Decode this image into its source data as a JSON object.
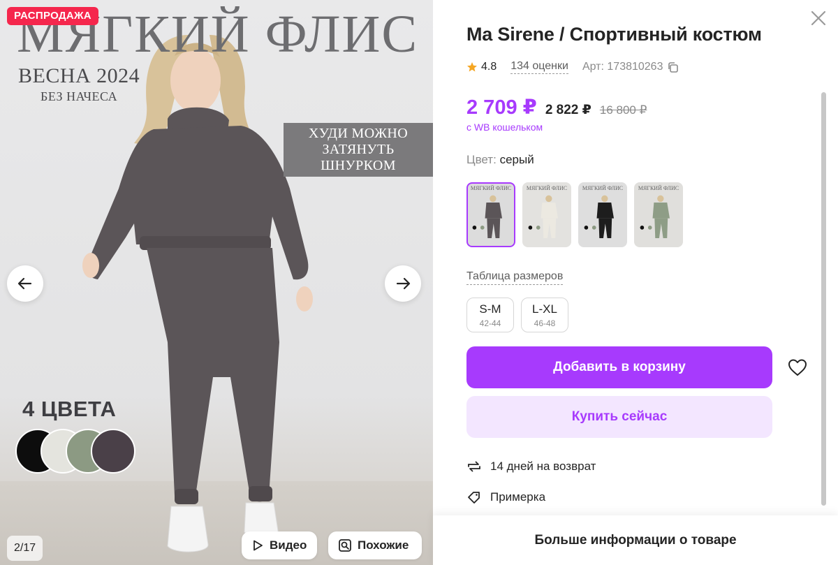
{
  "gallery": {
    "sale_badge": "РАСПРОДАЖА",
    "promo_title": "МЯГКИЙ ФЛИС",
    "promo_season": "ВЕСНА 2024",
    "promo_subtitle": "БЕЗ НАЧЕСА",
    "promo_hoodie_line1": "ХУДИ МОЖНО",
    "promo_hoodie_line2": "ЗАТЯНУТЬ ШНУРКОМ",
    "colors_title": "4 ЦВЕТА",
    "swatch_colors": [
      "#0d0d0d",
      "#e4e4de",
      "#8c9a83",
      "#4a4048"
    ],
    "counter": "2/17",
    "video_label": "Видео",
    "similar_label": "Похожие",
    "suit_color": "#5b5558"
  },
  "product": {
    "title": "Ma Sirene / Спортивный костюм",
    "rating": "4.8",
    "reviews": "134 оценки",
    "article": "Арт: 173810263",
    "price_wallet": "2 709 ₽",
    "price_regular": "2 822 ₽",
    "price_old": "16 800 ₽",
    "wallet_note": "с WB кошельком",
    "color_label": "Цвет:",
    "color_value": "серый",
    "thumbnail_caption": "МЯГКИЙ ФЛИС",
    "thumbnails": [
      {
        "name": "gray",
        "bg": "#dcdcdc",
        "suit": "#5b5558",
        "active": true
      },
      {
        "name": "milk",
        "bg": "#e3e2df",
        "suit": "#ece9e1",
        "active": false
      },
      {
        "name": "black",
        "bg": "#dedede",
        "suit": "#1d1d1d",
        "active": false
      },
      {
        "name": "olive",
        "bg": "#e0dfdc",
        "suit": "#8e9d86",
        "active": false
      }
    ],
    "size_table": "Таблица размеров",
    "sizes": [
      {
        "label": "S-M",
        "sub": "42-44"
      },
      {
        "label": "L-XL",
        "sub": "46-48"
      }
    ],
    "add_to_cart": "Добавить в корзину",
    "buy_now": "Купить сейчас",
    "return_text": "14 дней на возврат",
    "fitting_text": "Примерка",
    "more_info": "Больше информации о товаре"
  },
  "colors": {
    "accent": "#a73afd",
    "accent_light": "#f3e6ff",
    "sale": "#f5274d",
    "star": "#f5a623"
  }
}
